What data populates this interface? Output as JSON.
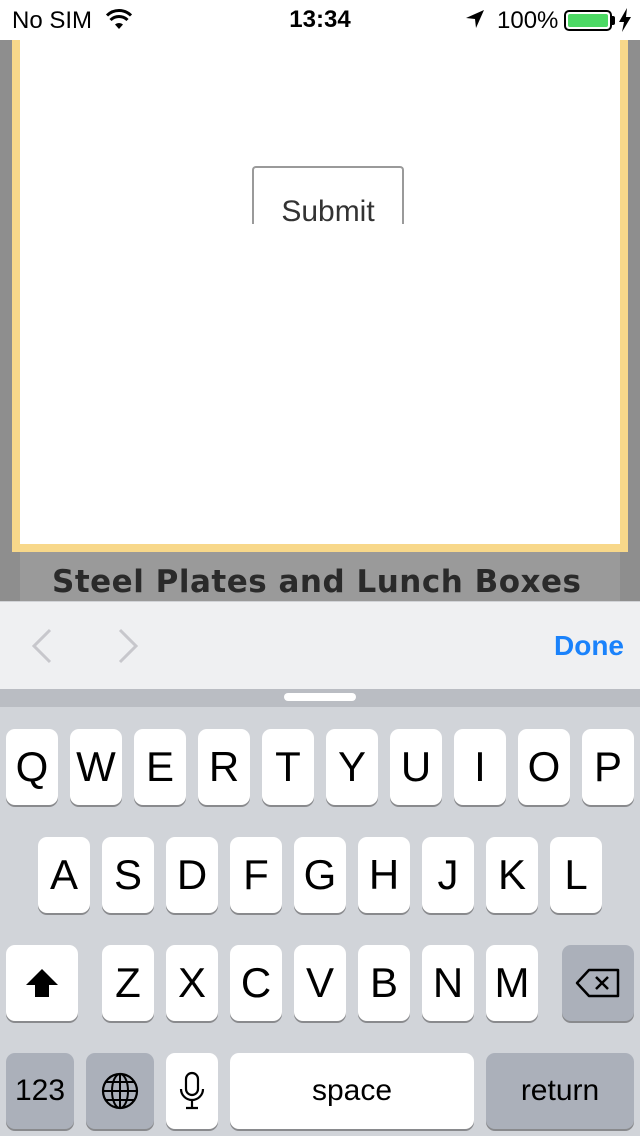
{
  "status_bar": {
    "carrier": "No SIM",
    "time": "13:34",
    "battery_percent": "100%",
    "battery_color": "#4cd964",
    "icons": [
      "wifi-icon",
      "location-arrow-icon",
      "battery-icon",
      "charging-bolt-icon"
    ]
  },
  "page": {
    "submit_label": "Submit",
    "heading": "Steel Plates and Lunch Boxes",
    "modal_border_color": "#f8d88a"
  },
  "accessory_bar": {
    "prev_icon": "chevron-left-icon",
    "next_icon": "chevron-right-icon",
    "done_label": "Done",
    "accent_color": "#1a82fb"
  },
  "keyboard": {
    "row1": [
      "Q",
      "W",
      "E",
      "R",
      "T",
      "Y",
      "U",
      "I",
      "O",
      "P"
    ],
    "row2": [
      "A",
      "S",
      "D",
      "F",
      "G",
      "H",
      "J",
      "K",
      "L"
    ],
    "row3": [
      "Z",
      "X",
      "C",
      "V",
      "B",
      "N",
      "M"
    ],
    "shift_icon": "shift-icon",
    "delete_icon": "backspace-icon",
    "numbers_label": "123",
    "globe_icon": "globe-icon",
    "mic_icon": "microphone-icon",
    "space_label": "space",
    "return_label": "return"
  }
}
